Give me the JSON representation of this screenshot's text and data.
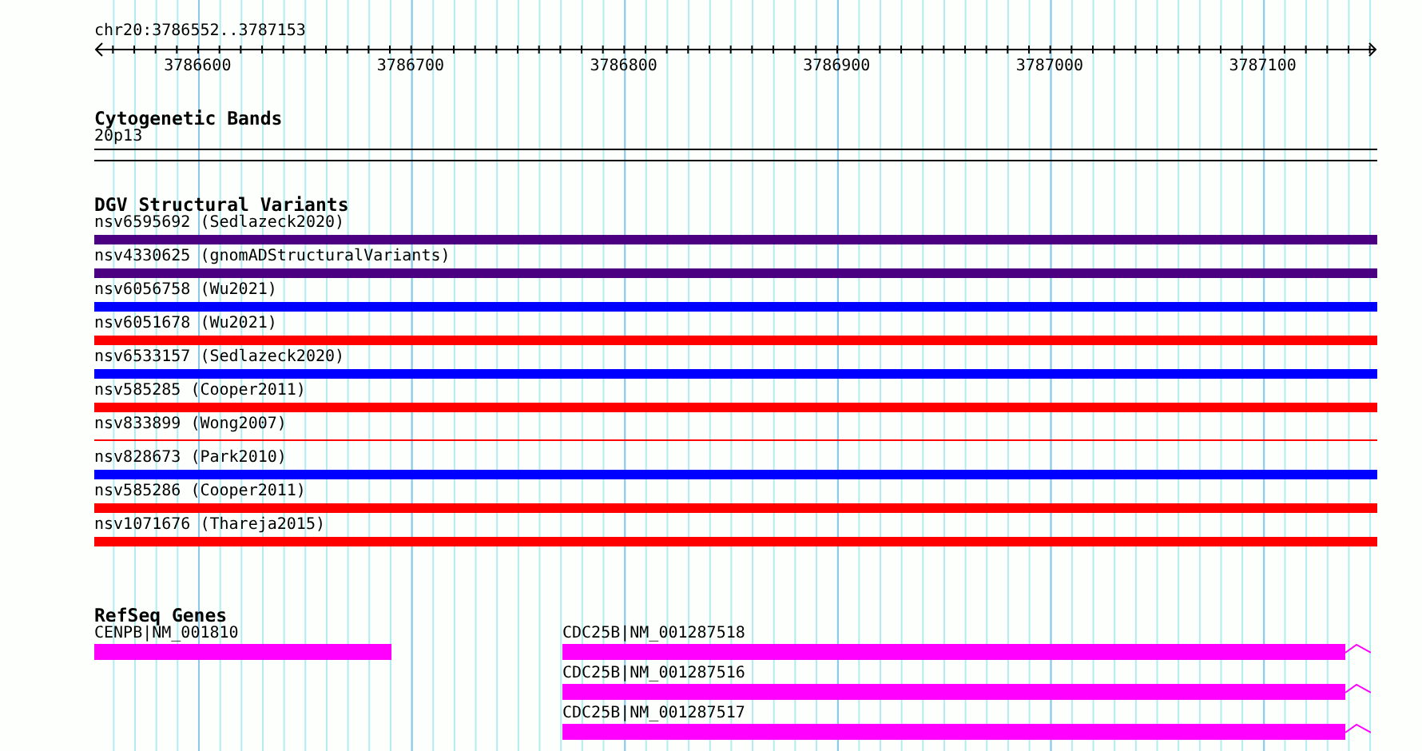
{
  "ruler": {
    "location": "chr20:3786552..3787153",
    "tick_labels": [
      "3786600",
      "3786700",
      "3786800",
      "3786900",
      "3787000",
      "3787100"
    ]
  },
  "cytogenetic_bands": {
    "title": "Cytogenetic Bands",
    "band": "20p13"
  },
  "dgv": {
    "title": "DGV Structural Variants",
    "variants": [
      {
        "label": "nsv6595692 (Sedlazeck2020)",
        "color": "#4b0082",
        "kind": "thick"
      },
      {
        "label": "nsv4330625 (gnomADStructuralVariants)",
        "color": "#4b0082",
        "kind": "thick"
      },
      {
        "label": "nsv6056758 (Wu2021)",
        "color": "#0000ff",
        "kind": "thick"
      },
      {
        "label": "nsv6051678 (Wu2021)",
        "color": "#ff0000",
        "kind": "thick"
      },
      {
        "label": "nsv6533157 (Sedlazeck2020)",
        "color": "#0000ff",
        "kind": "thick"
      },
      {
        "label": "nsv585285 (Cooper2011)",
        "color": "#ff0000",
        "kind": "thick"
      },
      {
        "label": "nsv833899 (Wong2007)",
        "color": "#ff0000",
        "kind": "thin"
      },
      {
        "label": "nsv828673 (Park2010)",
        "color": "#0000ff",
        "kind": "thick"
      },
      {
        "label": "nsv585286 (Cooper2011)",
        "color": "#ff0000",
        "kind": "thick"
      },
      {
        "label": "nsv1071676 (Thareja2015)",
        "color": "#ff0000",
        "kind": "thick"
      }
    ]
  },
  "refseq": {
    "title": "RefSeq Genes",
    "columns": [
      [
        {
          "label": "CENPB|NM_001810",
          "continues_right": false
        }
      ],
      [
        {
          "label": "CDC25B|NM_001287518",
          "continues_right": true
        },
        {
          "label": "CDC25B|NM_001287516",
          "continues_right": true
        },
        {
          "label": "CDC25B|NM_001287517",
          "continues_right": true
        }
      ]
    ]
  }
}
